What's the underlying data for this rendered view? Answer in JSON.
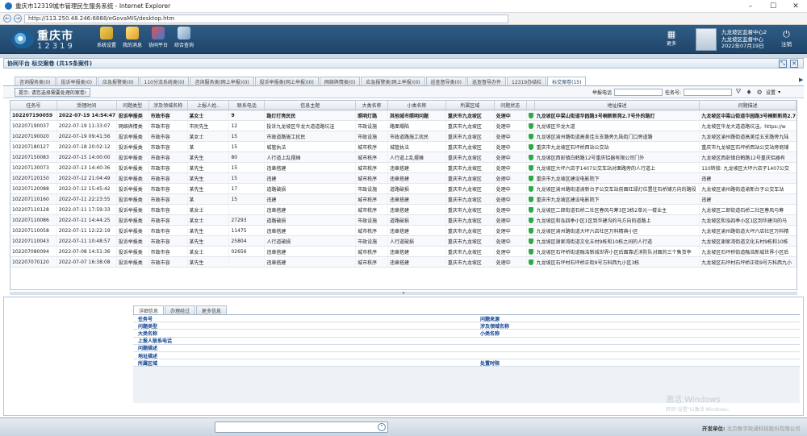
{
  "window": {
    "title": "重庆市12319城市管理民生服务系统 - Internet Explorer",
    "url": "http://113.250.48.246:6888/eGovaMIS/desktop.htm"
  },
  "header": {
    "logo_name": "重庆市",
    "logo_code": "12319",
    "menu": [
      "系统设置",
      "我的消息",
      "协同平台",
      "综合查询"
    ],
    "more": "更多",
    "user_line1": "九龙坡区监督中心2",
    "user_line2": "九龙坡区监督中心",
    "user_date": "2022年07月19日",
    "logout": "注销"
  },
  "panel": {
    "title": "协同平台 标交案卷 (共15条案件)"
  },
  "tabs": [
    "咨询服务类(0)",
    "投诉举报类(0)",
    "应急报警类(0)",
    "110分流系统类(0)",
    "咨询服务类(网上举报)(0)",
    "投诉举报类(网上举报)(0)",
    "网络舆情类(0)",
    "应急报警类(网上举报)(0)",
    "巡查督导类(0)",
    "巡查督导办件",
    "12319办结栏",
    "标交案卷(15)"
  ],
  "toolbar": {
    "hint": "提示: 请您选择需要处理的案卷!",
    "phone_label": "举报电话",
    "case_label": "任务号:",
    "settings": "设置"
  },
  "grid": {
    "headers": [
      "任务号",
      "受理时间",
      "问题类型",
      "涉及领域名称",
      "上报人姓..",
      "联系电话",
      "信息主题",
      "大类名称",
      "小类名称",
      "所属区域",
      "问题状态",
      "",
      "地址描述",
      "问题描述"
    ],
    "rows": [
      [
        "102207190059",
        "2022-07-19 14:54:47",
        "投诉举报类",
        "市政市容",
        "某女士",
        "9",
        "路灯打亮民民",
        "照明灯路",
        "其他城市照明问题",
        "重庆市九龙坡区",
        "处理中",
        "",
        "九龙坡区中梁山街道华园路3号桐新新苑2.7号外的路灯",
        "九龙坡区中梁山街道华园路3号桐新新苑2.7号"
      ],
      [
        "102207190037",
        "2022-07-19 11:33:07",
        "网络舆情类",
        "市政市容",
        "市民先生",
        "12",
        "投诉九龙坡区华龙大道道路坑洼",
        "市政设施",
        "路面塌陷",
        "重庆市九龙坡区",
        "处理中",
        "",
        "九龙坡区华龙大道",
        "九龙坡区华龙大道道路坑洼。https://w"
      ],
      [
        "102207190020",
        "2022-07-19 09:41:56",
        "投诉举报类",
        "市政市容",
        "某女士",
        "15",
        "市政道路施工扰民",
        "市政设施",
        "市政道路施工扰民",
        "重庆市九龙坡区",
        "处理中",
        "",
        "九龙坡区渝州路街道高美佳五支路旁九陆街门口旁道路",
        "九龙坡区渝州路街道高美佳五支路旁九陆"
      ],
      [
        "102207180127",
        "2022-07-18 20:02:12",
        "投诉举报类",
        "市政市容",
        "某",
        "15",
        "城管执法",
        "城市秩序",
        "城管执法",
        "重庆市九龙坡区",
        "处理中",
        "",
        "重庆市九龙坡区石坪桥西站公交站",
        "重庆市九龙坡区石坪桥西站公交站旁商铺"
      ],
      [
        "102207150083",
        "2022-07-15 14:00:00",
        "投诉举报类",
        "市政市容",
        "某先生",
        "80",
        "人行道上乱摆摊",
        "城市秩序",
        "人行道上乱摆摊",
        "重庆市九龙坡区",
        "处理中",
        "",
        "九龙坡区西彭镇白鹤路12号重庆铝器有限公司门外",
        "九龙坡区西彭镇白鹤路12号重庆铝器有"
      ],
      [
        "102207130073",
        "2022-07-13 14:40:36",
        "投诉举报类",
        "市政市容",
        "某先生",
        "15",
        "违章搭建",
        "城市秩序",
        "违章搭建",
        "重庆市九龙坡区",
        "处理中",
        "",
        "九龙坡区大坪六店子1407公交车站对面路旁的人行道上",
        "110转接: 九龙坡区大坪六店子1407公交"
      ],
      [
        "102207120150",
        "2022-07-12 21:04:49",
        "投诉举报类",
        "市政市容",
        "某先生",
        "15",
        "违建",
        "城市秩序",
        "违章搭建",
        "重庆市九龙坡区",
        "处理中",
        "",
        "重庆市九龙坡区建设电影院下",
        "违建"
      ],
      [
        "102207120088",
        "2022-07-12 15:45:42",
        "投诉举报类",
        "市政市容",
        "某先生",
        "17",
        "道路破损",
        "市政设施",
        "道路破损",
        "重庆市九龙坡区",
        "处理中",
        "",
        "九龙坡区渝州路街道渝新台子公交车站前面红绿灯位置往石桥铺方向的路段",
        "九龙坡区渝州路街道渝新台子公交车站"
      ],
      [
        "102207110160",
        "2022-07-11 22:23:55",
        "投诉举报类",
        "市政市容",
        "某",
        "15",
        "违建",
        "城市秩序",
        "违章搭建",
        "重庆市九龙坡区",
        "处理中",
        "",
        "重庆市九龙坡区建设电影院下",
        "违建"
      ],
      [
        "102207110128",
        "2022-07-11 17:59:33",
        "投诉举报类",
        "市政市容",
        "某女士",
        "",
        "违章搭建",
        "城市秩序",
        "违章搭建",
        "重庆市九龙坡区",
        "处理中",
        "",
        "九龙坡区二郎街道石桥二社区春风与筹3区3栋2单元一楼业主",
        "九龙坡区二郎街道石桥二社区春风与筹"
      ],
      [
        "102207110086",
        "2022-07-11 14:44:25",
        "投诉举报类",
        "市政市容",
        "某女士",
        "27293",
        "道路破损",
        "市政设施",
        "道路破损",
        "重庆市九龙坡区",
        "处理中",
        "",
        "九龙坡区和泓四季小区1区到华建沟的马方向的道路上",
        "九龙坡区和泓四季小区1区到华建沟的马"
      ],
      [
        "102207110058",
        "2022-07-11 12:22:19",
        "投诉举报类",
        "市政市容",
        "某先生",
        "11475",
        "违章搭建",
        "城市秩序",
        "违章搭建",
        "重庆市九龙坡区",
        "处理中",
        "",
        "九龙坡区渝州路街道大坪六店社区万科精典小区",
        "九龙坡区渝州路街道大坪六店社区万科精"
      ],
      [
        "102207110043",
        "2022-07-11 10:48:57",
        "投诉举报类",
        "市政市容",
        "某先生",
        "25804",
        "人行道破损",
        "市政设施",
        "人行道破损",
        "重庆市九龙坡区",
        "处理中",
        "",
        "九龙坡区谢家湾街道文化五村9栋和10栋之间的人行道",
        "九龙坡区谢家湾街道文化五村9栋和10栋"
      ],
      [
        "102207080094",
        "2022-07-08 14:51:36",
        "投诉举报类",
        "市政市容",
        "某女士",
        "02656",
        "违章搭建",
        "城市秩序",
        "违章搭建",
        "重庆市九龙坡区",
        "处理中",
        "",
        "九龙坡区石坪桥街道融浩新城世界小区后面靠近消防队对面的三个售货亭",
        "九龙坡区石坪桥街道融浩新城世界小区后"
      ],
      [
        "102207070120",
        "2022-07-07 16:38:08",
        "投诉举报类",
        "市政市容",
        "某先生",
        "",
        "违章搭建",
        "城市秩序",
        "违章搭建",
        "重庆市九龙坡区",
        "处理中",
        "",
        "九龙坡区石坪村石坪桥正街9号万科西九小区3栋",
        "九龙坡区石坪村石坪桥正街9号万科西九小"
      ]
    ]
  },
  "detail": {
    "tabs": [
      "详细信息",
      "办理经过",
      "更多信息"
    ],
    "rows": [
      [
        "任务号",
        "问题来源"
      ],
      [
        "问题类型",
        "涉及领域名称"
      ],
      [
        "大类名称",
        "小类名称"
      ],
      [
        "上报人联系电话",
        ""
      ],
      [
        "问题描述",
        ""
      ],
      [
        "地址描述",
        ""
      ],
      [
        "所属区域",
        "处置时限"
      ]
    ]
  },
  "watermark": {
    "line1": "激活 Windows",
    "line2": "转到\"设置\"以激活 Windows。"
  },
  "footer": {
    "dev_label": "开发单位:",
    "dev_value": "北京数字政通科技股份有限公司"
  }
}
